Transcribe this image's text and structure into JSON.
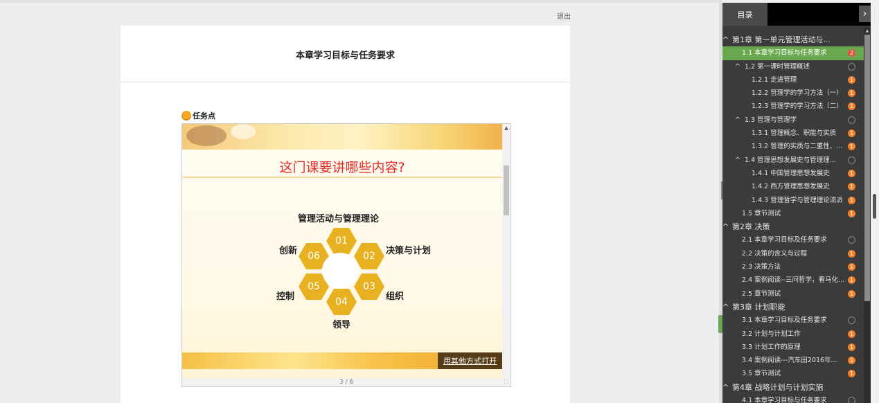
{
  "header": {
    "logout_label": "退出"
  },
  "main": {
    "title": "本章学习目标与任务要求",
    "task_label": "任务点",
    "viewer": {
      "slide_heading": "这门课要讲哪些内容?",
      "diagram": {
        "hex_numbers": [
          "01",
          "02",
          "03",
          "04",
          "05",
          "06"
        ],
        "labels": {
          "top": "管理活动与管理理论",
          "right_top": "决策与计划",
          "right_bottom": "组织",
          "bottom": "领导",
          "left_bottom": "控制",
          "left_top": "创新"
        }
      },
      "open_other_label": "用其他方式打开",
      "pager": "3 / 6",
      "fullscreen_icon": "fullscreen-icon"
    }
  },
  "sidebar": {
    "tab_label": "目录",
    "close_symbol": "›",
    "items": [
      {
        "label": "第1章 第一单元管理活动与...",
        "level": 0,
        "chapter": true,
        "badge": null
      },
      {
        "label": "1.1 本章学习目标与任务要求",
        "level": 1,
        "active": true,
        "badge": "2",
        "badge_type": "red"
      },
      {
        "label": "1.2 第一课时管理概述",
        "level": 1,
        "collapsible": true,
        "badge": "",
        "badge_type": "empty"
      },
      {
        "label": "1.2.1 走进管理",
        "level": 2,
        "badge": "1",
        "badge_type": "orange"
      },
      {
        "label": "1.2.2 管理学的学习方法（一）",
        "level": 2,
        "badge": "1",
        "badge_type": "orange"
      },
      {
        "label": "1.2.3 管理学的学习方法（二）",
        "level": 2,
        "badge": "1",
        "badge_type": "orange"
      },
      {
        "label": "1.3 管理与管理学",
        "level": 1,
        "collapsible": true,
        "badge": "",
        "badge_type": "empty"
      },
      {
        "label": "1.3.1 管理概念、职能与实质",
        "level": 2,
        "badge": "1",
        "badge_type": "orange"
      },
      {
        "label": "1.3.2 管理的实质与二重性、...",
        "level": 2,
        "badge": "1",
        "badge_type": "orange"
      },
      {
        "label": "1.4 管理思想发展史与管理理...",
        "level": 1,
        "collapsible": true,
        "badge": "",
        "badge_type": "empty"
      },
      {
        "label": "1.4.1 中国管理思想发展史",
        "level": 2,
        "badge": "1",
        "badge_type": "orange"
      },
      {
        "label": "1.4.2 西方管理思想发展史",
        "level": 2,
        "badge": "1",
        "badge_type": "orange"
      },
      {
        "label": "1.4.3 管理哲学与管理理论流派",
        "level": 2,
        "badge": "1",
        "badge_type": "orange"
      },
      {
        "label": "1.5 章节测试",
        "level": 1,
        "badge": "1",
        "badge_type": "orange"
      },
      {
        "label": "第2章 决策",
        "level": 0,
        "chapter": true,
        "badge": null
      },
      {
        "label": "2.1 本章学习目标及任务要求",
        "level": 1,
        "badge": "",
        "badge_type": "empty"
      },
      {
        "label": "2.2 决策的含义与过程",
        "level": 1,
        "badge": "1",
        "badge_type": "orange"
      },
      {
        "label": "2.3 决策方法",
        "level": 1,
        "badge": "1",
        "badge_type": "orange"
      },
      {
        "label": "2.4 案例阅读--三问哲学，看马化...",
        "level": 1,
        "badge": "1",
        "badge_type": "orange"
      },
      {
        "label": "2.5 章节测试",
        "level": 1,
        "badge": "1",
        "badge_type": "orange"
      },
      {
        "label": "第3章 计划职能",
        "level": 0,
        "chapter": true,
        "badge": null
      },
      {
        "label": "3.1 本章学习目标及任务要求",
        "level": 1,
        "badge": "",
        "badge_type": "empty"
      },
      {
        "label": "3.2 计划与计划工作",
        "level": 1,
        "badge": "1",
        "badge_type": "orange"
      },
      {
        "label": "3.3 计划工作的原理",
        "level": 1,
        "badge": "1",
        "badge_type": "orange"
      },
      {
        "label": "3.4 案例阅读---汽车田2016年...",
        "level": 1,
        "badge": "1",
        "badge_type": "orange"
      },
      {
        "label": "3.5 章节测试",
        "level": 1,
        "badge": "1",
        "badge_type": "orange"
      },
      {
        "label": "第4章 战略计划与计划实施",
        "level": 0,
        "chapter": true,
        "badge": null
      },
      {
        "label": "4.1 本章学习目标与任务要求",
        "level": 1,
        "badge": "",
        "badge_type": "empty"
      }
    ]
  }
}
